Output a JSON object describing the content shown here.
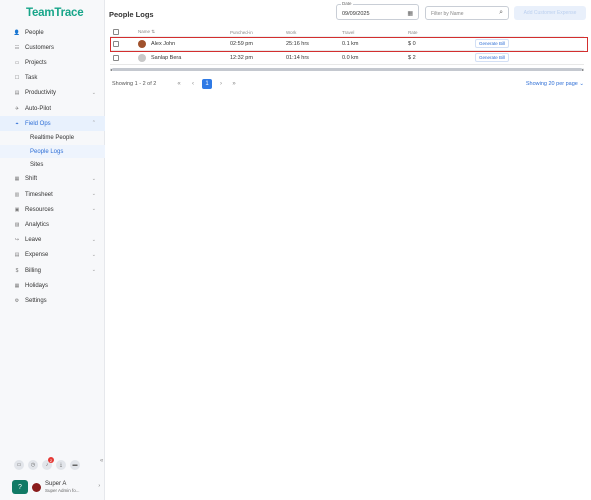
{
  "app": {
    "logo": "TeamTrace"
  },
  "sidebar": {
    "items": [
      {
        "label": "People",
        "icon": "person-icon",
        "chev": ""
      },
      {
        "label": "Customers",
        "icon": "customers-icon",
        "chev": ""
      },
      {
        "label": "Projects",
        "icon": "folder-icon",
        "chev": ""
      },
      {
        "label": "Task",
        "icon": "task-icon",
        "chev": ""
      },
      {
        "label": "Productivity",
        "icon": "productivity-icon",
        "chev": "⌄"
      },
      {
        "label": "Auto-Pilot",
        "icon": "autopilot-icon",
        "chev": ""
      },
      {
        "label": "Field Ops",
        "icon": "field-ops-icon",
        "chev": "⌃"
      }
    ],
    "field_ops_sub": [
      {
        "label": "Realtime People"
      },
      {
        "label": "People Logs"
      },
      {
        "label": "Sites"
      }
    ],
    "items_after": [
      {
        "label": "Shift",
        "icon": "shift-icon",
        "chev": "⌄"
      },
      {
        "label": "Timesheet",
        "icon": "timesheet-icon",
        "chev": "⌄"
      },
      {
        "label": "Resources",
        "icon": "resources-icon",
        "chev": "⌄"
      },
      {
        "label": "Analytics",
        "icon": "analytics-icon",
        "chev": ""
      },
      {
        "label": "Leave",
        "icon": "leave-icon",
        "chev": "⌄"
      },
      {
        "label": "Expense",
        "icon": "expense-icon",
        "chev": "⌄"
      },
      {
        "label": "Billing",
        "icon": "billing-icon",
        "chev": "⌄"
      },
      {
        "label": "Holidays",
        "icon": "holidays-icon",
        "chev": ""
      },
      {
        "label": "Settings",
        "icon": "settings-icon",
        "chev": ""
      }
    ],
    "notification_count": "2",
    "user": {
      "name": "Super A",
      "role": "Super Admin fo..."
    }
  },
  "main": {
    "title": "People Logs",
    "date": {
      "label": "Date",
      "value": "09/09/2025"
    },
    "filter": {
      "placeholder": "Filter by Name"
    },
    "add_button": "Add Customer Expense",
    "columns": [
      "Name ⇅",
      "Punched-in",
      "Work",
      "Travel",
      "Rate"
    ],
    "rows": [
      {
        "name": "Alex John",
        "punched_in": "02:59 pm",
        "work": "25:16 hrs",
        "travel": "0.1 km",
        "rate": "$ 0",
        "action": "Generate Bill",
        "avatar_color": "#a0522d"
      },
      {
        "name": "Sanlap Bera",
        "punched_in": "12:32 pm",
        "work": "01:14 hrs",
        "travel": "0.0 km",
        "rate": "$ 2",
        "action": "Generate Bill",
        "avatar_color": "#c8c8c8"
      }
    ],
    "pager": {
      "showing": "Showing 1 - 2 of 2",
      "first": "«",
      "prev": "‹",
      "page": "1",
      "next": "›",
      "last": "»",
      "per_page": "Showing 20 per page ⌄"
    }
  },
  "colors": {
    "brand": "#17a589",
    "accent": "#2f6fd6",
    "highlight": "#d32f2f"
  }
}
